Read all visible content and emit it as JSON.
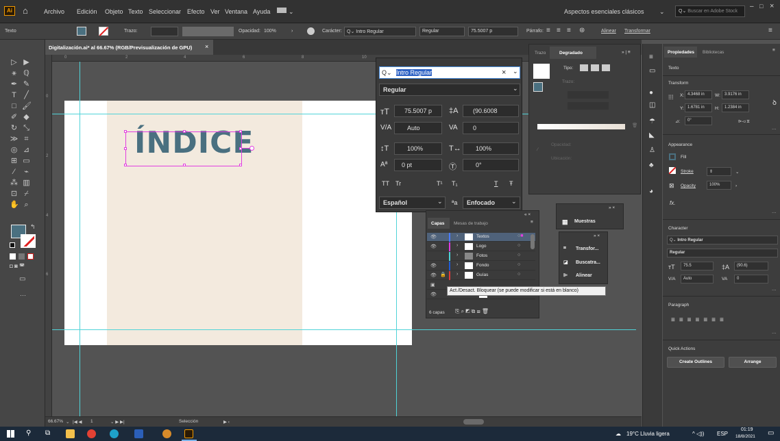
{
  "menubar": {
    "items": [
      "Archivo",
      "Edición",
      "Objeto",
      "Texto",
      "Seleccionar",
      "Efecto",
      "Ver",
      "Ventana",
      "Ayuda"
    ],
    "workspace": "Aspectos esenciales clásicos",
    "search_placeholder": "Buscar en Adobe Stock"
  },
  "ctrlbar": {
    "mode": "Texto",
    "stroke_label": "Trazo:",
    "opacity_label": "Opacidad:",
    "opacity_value": "100%",
    "char_label": "Carácter:",
    "font": "Intro Regular",
    "style": "Regular",
    "size": "75.5007 p",
    "para_label": "Párrafo:",
    "align": "Alinear",
    "transform": "Transformar"
  },
  "document": {
    "tab_title": "Digitalización.ai* al 66.67% (RGB/Previsualización de GPU)",
    "ruler_marks": [
      "0",
      "2",
      "4",
      "6",
      "8",
      "10"
    ],
    "artboard_text": "ÍNDICE"
  },
  "statusbar": {
    "zoom": "66.67%",
    "page": "1",
    "tool": "Selección"
  },
  "font_dropdown": {
    "font": "Intro Regular",
    "style": "Regular",
    "size": "75.5007 p",
    "leading": "(90.6008",
    "kerning": "Auto",
    "tracking": "0",
    "vscale": "100%",
    "hscale": "100%",
    "baseline": "0 pt",
    "rotation": "0°",
    "language": "Español",
    "antialias": "Enfocado",
    "caps": [
      "TT",
      "Tr",
      "T¹",
      "T₁",
      "T",
      "Ŧ"
    ]
  },
  "gradient_panel": {
    "tabs": [
      "Trazo",
      "Degradado"
    ],
    "tipo": "Tipo:",
    "trazo": "Trazo:",
    "opacidad": "Opacidad:",
    "ubicacion": "Ubicación:"
  },
  "layers": {
    "tabs": [
      "Capas",
      "Mesas de trabajo"
    ],
    "rows": [
      {
        "name": "Textos",
        "color": "#4a7cff"
      },
      {
        "name": "Logo",
        "color": "#e13ee0"
      },
      {
        "name": "Fotos",
        "color": "#4fd3d8"
      },
      {
        "name": "Fondo",
        "color": "#1f5bd6"
      },
      {
        "name": "Guías",
        "color": "#e03a3a"
      },
      {
        "name": "",
        "color": "#ffffff"
      },
      {
        "name": "#...",
        "color": "#ffffff"
      }
    ],
    "count": "6 capas",
    "tooltip": "Act./Desact. Bloquear (se puede modificar si está en blanco)"
  },
  "mini_panels": {
    "muestras": "Muestras",
    "transform": "Transfor...",
    "buscatrazos": "Buscatra...",
    "alinear": "Alinear"
  },
  "properties": {
    "tabs": [
      "Propiedades",
      "Bibliotecas"
    ],
    "section_texto": "Texto",
    "transform_title": "Transform",
    "x": "4.3468 in",
    "w": "3.9176 in",
    "y": "1.6781 in",
    "h": "1.2384 in",
    "angle": "0°",
    "appearance": "Appearance",
    "fill": "Fill",
    "stroke": "Stroke",
    "opacity_label": "Opacity",
    "opacity": "100%",
    "fx": "fx.",
    "character": "Character",
    "font": "Intro Regular",
    "style": "Regular",
    "size": "75.5",
    "leading": "(90.6)",
    "kerning": "Auto",
    "tracking": "0",
    "paragraph": "Paragraph",
    "quick_actions": "Quick Actions",
    "create_outlines": "Create Outlines",
    "arrange": "Arrange"
  },
  "taskbar": {
    "weather": "19°C  Lluvia ligera",
    "lang": "ESP",
    "time": "01:19",
    "date": "18/8/2021"
  }
}
